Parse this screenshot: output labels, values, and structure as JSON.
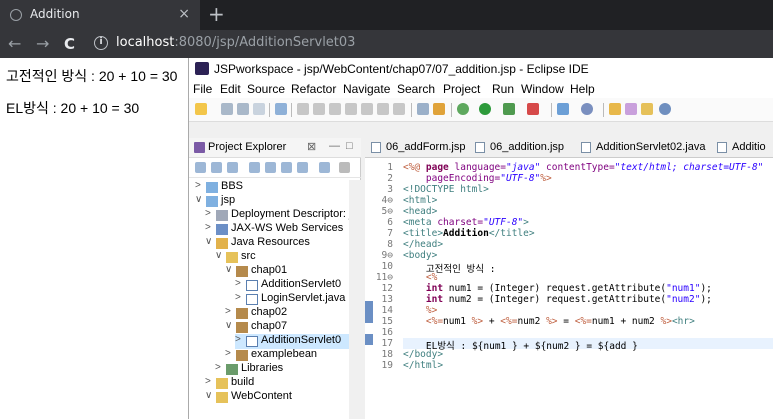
{
  "browser": {
    "tab_title": "Addition",
    "tab_close": "×",
    "new_tab": "+",
    "back": "←",
    "forward": "→",
    "reload": "C",
    "url_host": "localhost",
    "url_rest": ":8080/jsp/AdditionServlet03"
  },
  "page": {
    "line1": "고전적인 방식 : 20 + 10 = 30",
    "line2": "EL방식 : 20 + 10 = 30"
  },
  "eclipse": {
    "title": "JSPworkspace - jsp/WebContent/chap07/07_addition.jsp - Eclipse IDE",
    "menu": [
      "File",
      "Edit",
      "Source",
      "Refactor",
      "Navigate",
      "Search",
      "Project",
      "Run",
      "Window",
      "Help"
    ],
    "explorer": {
      "title": "Project Explorer",
      "close": "⊠",
      "tree": [
        {
          "label": "BBS",
          "arrow": ">"
        },
        {
          "label": "jsp",
          "arrow": "∨"
        },
        {
          "label": "Deployment Descriptor: js",
          "arrow": ">"
        },
        {
          "label": "JAX-WS Web Services",
          "arrow": ">"
        },
        {
          "label": "Java Resources",
          "arrow": "∨"
        },
        {
          "label": "src",
          "arrow": "∨"
        },
        {
          "label": "chap01",
          "arrow": "∨"
        },
        {
          "label": "AdditionServlet0",
          "arrow": ">"
        },
        {
          "label": "LoginServlet.java",
          "arrow": ">"
        },
        {
          "label": "chap02",
          "arrow": ">"
        },
        {
          "label": "chap07",
          "arrow": "∨"
        },
        {
          "label": "AdditionServlet0",
          "arrow": ">"
        },
        {
          "label": "examplebean",
          "arrow": ">"
        },
        {
          "label": "Libraries",
          "arrow": ">"
        },
        {
          "label": "build",
          "arrow": ">"
        },
        {
          "label": "WebContent",
          "arrow": "∨"
        }
      ]
    },
    "editor_tabs": [
      "06_addForm.jsp",
      "06_addition.jsp",
      "AdditionServlet02.java",
      "Additio"
    ],
    "line_numbers": [
      "1",
      "2",
      "3",
      "4⊖",
      "5⊖",
      "6",
      "7",
      "8",
      "9⊖",
      "10",
      "11⊖",
      "12",
      "13",
      "14",
      "15",
      "16",
      "17",
      "18",
      "19"
    ]
  },
  "code": {
    "l1a": "<%@ ",
    "l1b": "page ",
    "l1c": "language=",
    "l1d": "\"java\"",
    "l1e": " contentType=",
    "l1f": "\"text/html; charset=UTF-8\"",
    "l2a": "    pageEncoding=",
    "l2b": "\"UTF-8\"",
    "l2c": "%>",
    "l3": "<!DOCTYPE html>",
    "l4": "<html>",
    "l5": "<head>",
    "l6a": "<meta ",
    "l6b": "charset=",
    "l6c": "\"UTF-8\"",
    "l6d": ">",
    "l7a": "<title>",
    "l7b": "Addition",
    "l7c": "</title>",
    "l8": "</head>",
    "l9": "<body>",
    "l10": "    고전적인 방식 :",
    "l11": "    <%",
    "l12a": "    int",
    "l12b": " num1 = (Integer) request.getAttribute(",
    "l12c": "\"num1\"",
    "l12d": ");",
    "l13a": "    int",
    "l13b": " num2 = (Integer) request.getAttribute(",
    "l13c": "\"num2\"",
    "l13d": ");",
    "l14": "    %>",
    "l15a": "    <%=",
    "l15b": "num1 ",
    "l15c": "%>",
    "l15d": " + ",
    "l15e": "<%=",
    "l15f": "num2 ",
    "l15g": "%>",
    "l15h": " = ",
    "l15i": "<%=",
    "l15j": "num1 + num2 ",
    "l15k": "%>",
    "l15l": "<hr>",
    "l16": "",
    "l17": "    EL방식 : ${num1 } + ${num2 } = ${add }",
    "l18": "</body>",
    "l19": "</html>"
  }
}
